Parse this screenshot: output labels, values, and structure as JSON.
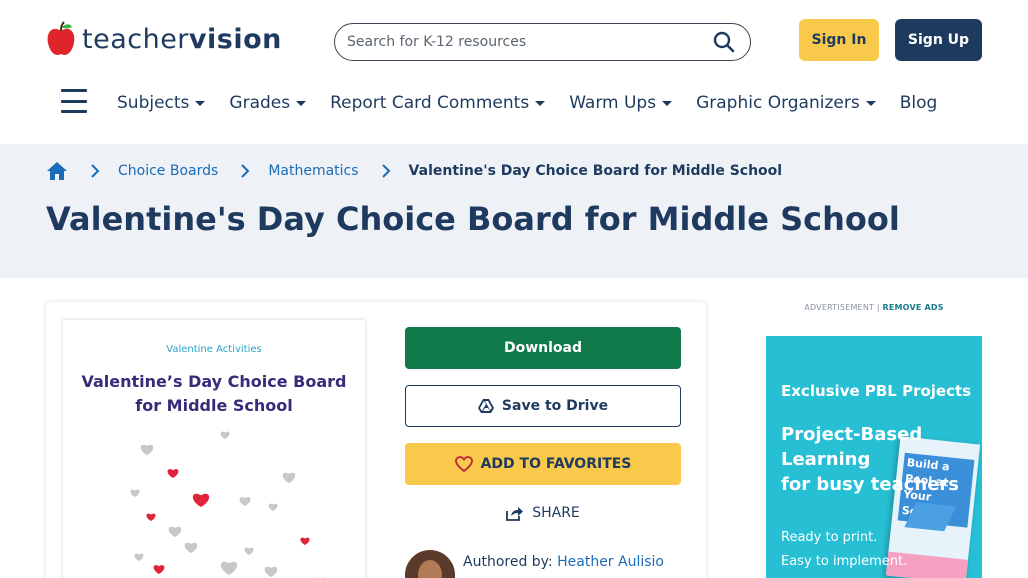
{
  "brand": {
    "logo_light": "teacher",
    "logo_bold": "vision",
    "colors": {
      "navy": "#1f3a5f",
      "yellow": "#f8c94a",
      "green": "#117a4a",
      "link": "#1a6bb8",
      "ad_bg": "#27bfd4"
    }
  },
  "search": {
    "placeholder": "Search for K-12 resources",
    "value": ""
  },
  "auth": {
    "signin_label": "Sign In",
    "signup_label": "Sign Up"
  },
  "nav": {
    "items": [
      {
        "label": "Subjects",
        "has_caret": true
      },
      {
        "label": "Grades",
        "has_caret": true
      },
      {
        "label": "Report Card Comments",
        "has_caret": true
      },
      {
        "label": "Warm Ups",
        "has_caret": true
      },
      {
        "label": "Graphic Organizers",
        "has_caret": true
      },
      {
        "label": "Blog",
        "has_caret": false
      }
    ]
  },
  "breadcrumb": {
    "items": [
      {
        "label": "Choice Boards"
      },
      {
        "label": "Mathematics"
      }
    ],
    "current": "Valentine's Day Choice Board for Middle School"
  },
  "page": {
    "title": "Valentine's Day Choice Board for Middle School"
  },
  "thumbnail": {
    "kicker": "Valentine Activities",
    "title_line1": "Valentine’s Day Choice Board",
    "title_line2": "for Middle School"
  },
  "actions": {
    "download_label": "Download",
    "drive_label": "Save to Drive",
    "favorites_label": "ADD TO FAVORITES",
    "share_label": "SHARE"
  },
  "author": {
    "prefix": "Authored by:",
    "name": "Heather Aulisio"
  },
  "ad": {
    "label": "ADVERTISEMENT |",
    "remove_label": "REMOVE ADS",
    "kicker": "Exclusive PBL Projects",
    "headline_line1": "Project-Based",
    "headline_line2": "Learning",
    "headline_line3": "for busy teachers",
    "body_line1": "Ready to print.",
    "body_line2": "Easy to implement.",
    "book_title": "Build a Pool at Your School"
  }
}
